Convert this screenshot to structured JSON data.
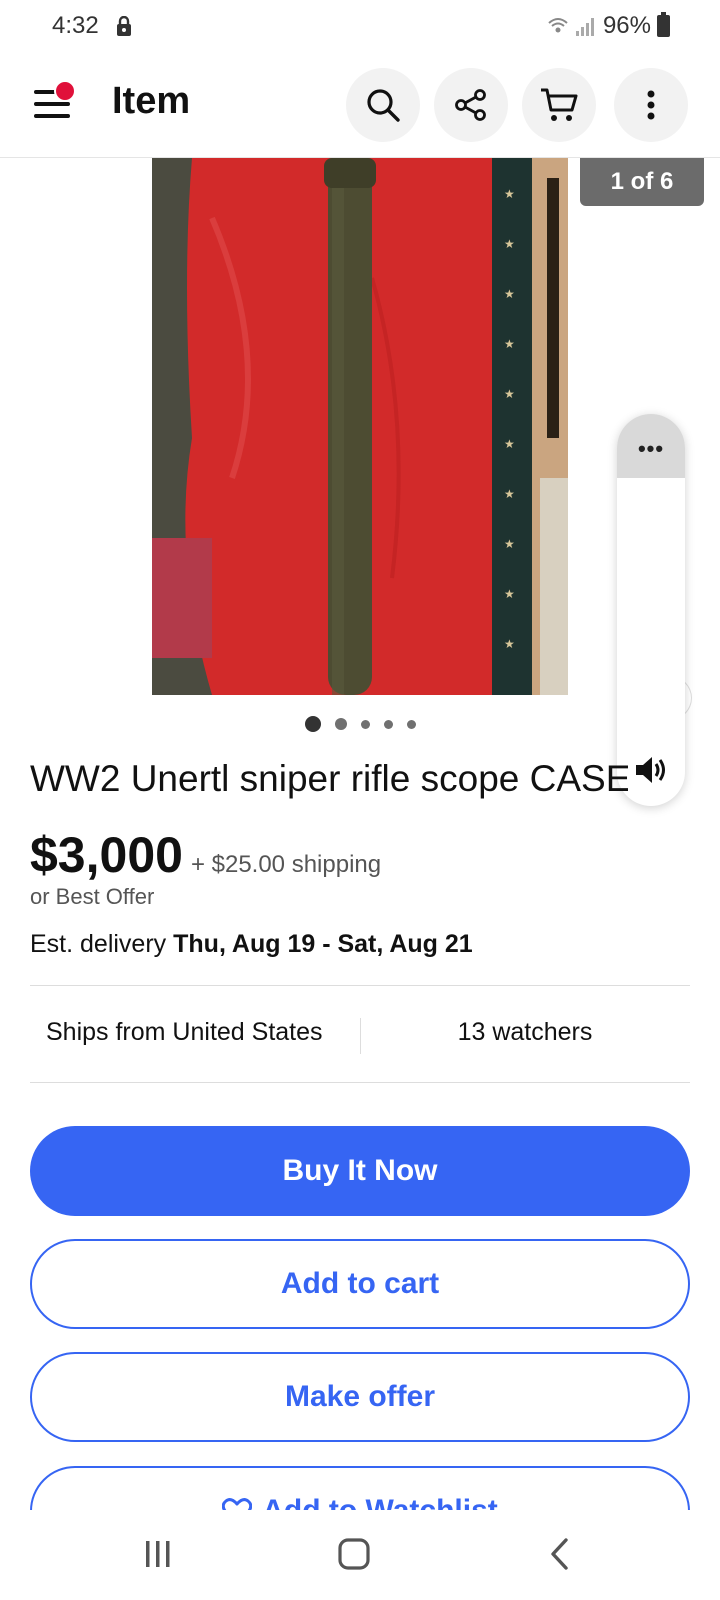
{
  "status_bar": {
    "time": "4:32",
    "battery": "96%"
  },
  "header": {
    "title": "Item",
    "icons": [
      "menu-icon",
      "search-icon",
      "share-icon",
      "cart-icon",
      "more-vertical-icon"
    ]
  },
  "gallery": {
    "counter": "1 of 6",
    "dot_count": 5,
    "active_dot": 0
  },
  "listing": {
    "title": "WW2 Unertl sniper rifle scope CASE",
    "price": "$3,000",
    "shipping": "+ $25.00 shipping",
    "best_offer": "or Best Offer",
    "delivery_label": "Est. delivery",
    "delivery_dates": "Thu, Aug 19 - Sat, Aug 21",
    "ships_from": "Ships from United States",
    "watchers": "13 watchers"
  },
  "actions": {
    "buy_now": "Buy It Now",
    "add_to_cart": "Add to cart",
    "make_offer": "Make offer",
    "add_to_watchlist": "Add to Watchlist"
  },
  "floating_panel": {
    "more": "•••"
  },
  "colors": {
    "accent": "#3665f3",
    "badge": "#e0103a"
  }
}
